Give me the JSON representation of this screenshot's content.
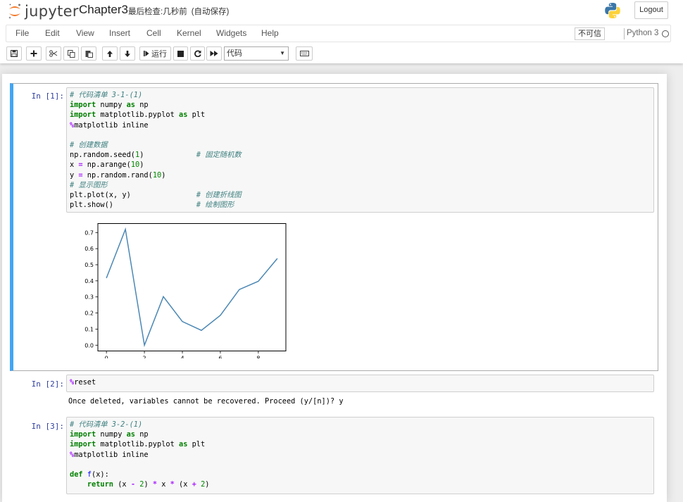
{
  "header": {
    "logo_text": "jupyter",
    "notebook_name": "Chapter3",
    "checkpoint_label": "最后检查:",
    "checkpoint_time": "几秒前",
    "autosave": "(自动保存)",
    "logout_label": "Logout"
  },
  "menubar": {
    "items": [
      "File",
      "Edit",
      "View",
      "Insert",
      "Cell",
      "Kernel",
      "Widgets",
      "Help"
    ],
    "trusted_label": "不可信",
    "kernel_name": "Python 3"
  },
  "toolbar": {
    "run_label": "运行",
    "cell_type": "代码"
  },
  "cells": [
    {
      "prompt": "In  [1]:",
      "code_lines": [
        "# 代码清单 3-1-(1)",
        "import numpy as np",
        "import matplotlib.pyplot as plt",
        "%matplotlib inline",
        "",
        "# 创建数据",
        "np.random.seed(1)            # 固定随机数",
        "x = np.arange(10)",
        "y = np.random.rand(10)",
        "# 显示图形",
        "plt.plot(x, y)               # 创建折线图",
        "plt.show()                   # 绘制图形"
      ]
    },
    {
      "prompt": "In  [2]:",
      "code_lines": [
        "%reset"
      ],
      "output": "Once deleted, variables cannot be recovered. Proceed (y/[n])? y"
    },
    {
      "prompt": "In  [3]:",
      "code_lines": [
        "# 代码清单 3-2-(1)",
        "import numpy as np",
        "import matplotlib.pyplot as plt",
        "%matplotlib inline",
        "",
        "def f(x):",
        "    return (x - 2) * x * (x + 2)"
      ]
    }
  ],
  "chart_data": {
    "type": "line",
    "title": "",
    "xlabel": "",
    "ylabel": "",
    "x": [
      0,
      1,
      2,
      3,
      4,
      5,
      6,
      7,
      8,
      9
    ],
    "series": [
      {
        "values": [
          0.417,
          0.72,
          0.0,
          0.302,
          0.147,
          0.092,
          0.186,
          0.346,
          0.397,
          0.539
        ],
        "color": "#4c88b4"
      }
    ],
    "xticks": [
      0,
      2,
      4,
      6,
      8
    ],
    "yticks": [
      0.0,
      0.1,
      0.2,
      0.3,
      0.4,
      0.5,
      0.6,
      0.7
    ],
    "xlim": [
      -0.45,
      9.45
    ],
    "ylim": [
      -0.036,
      0.756
    ],
    "grid": false,
    "legend": "none"
  }
}
